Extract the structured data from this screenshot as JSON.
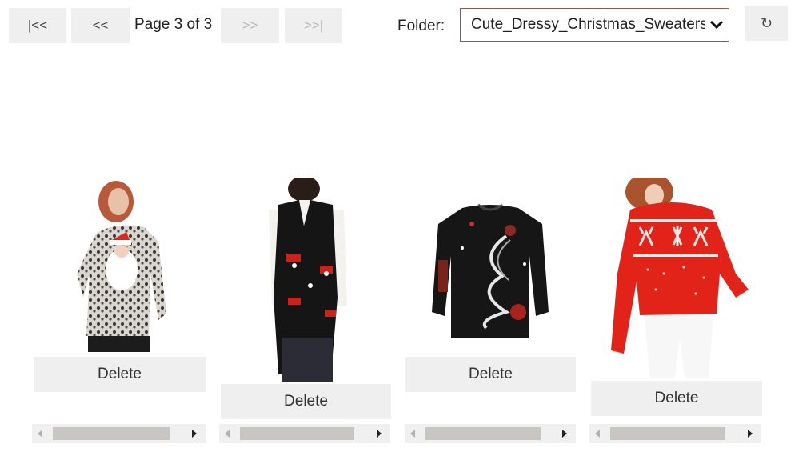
{
  "pager": {
    "first_label": "|<<",
    "prev_label": "<<",
    "page_text": "Page 3 of 3",
    "next_label": ">>",
    "last_label": ">>|"
  },
  "folder": {
    "label": "Folder:",
    "selected": "Cute_Dressy_Christmas_Sweaters"
  },
  "refresh_icon": "↻",
  "items": [
    {
      "delete_label": "Delete",
      "image": "leopard-santa-sweater"
    },
    {
      "delete_label": "Delete",
      "image": "black-santa-vest"
    },
    {
      "delete_label": "Delete",
      "image": "black-christmas-tree-sweater"
    },
    {
      "delete_label": "Delete",
      "image": "red-reindeer-sweater"
    }
  ],
  "colors": {
    "button_bg": "#efefef",
    "select_border": "#8c5a55",
    "sweater_red": "#e2231a"
  }
}
